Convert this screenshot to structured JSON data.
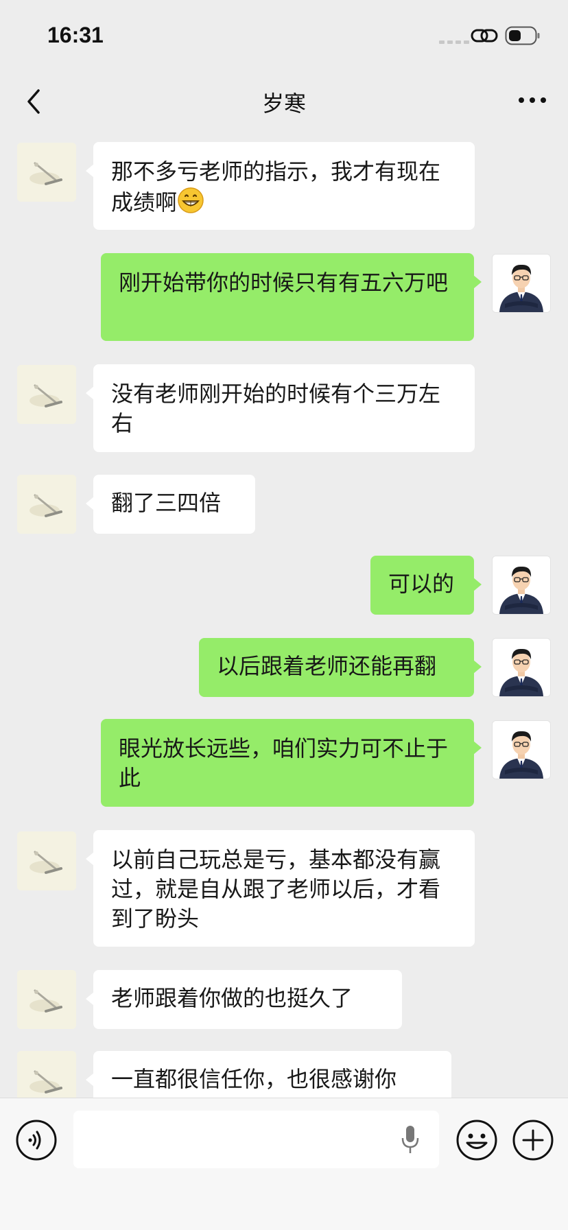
{
  "status_bar": {
    "time": "16:31"
  },
  "header": {
    "title": "岁寒",
    "back_icon": "chevron-left-icon",
    "more_icon": "more-dots-icon"
  },
  "messages": [
    {
      "side": "left",
      "text": "那不多亏老师的指示，我才有现在成绩啊",
      "emoji": "grinning-emoji"
    },
    {
      "side": "right",
      "text": "刚开始带你的时候只有有五六万吧"
    },
    {
      "side": "left",
      "text": "没有老师刚开始的时候有个三万左右"
    },
    {
      "side": "left",
      "text": "翻了三四倍"
    },
    {
      "side": "right",
      "text": "可以的"
    },
    {
      "side": "right",
      "text": "以后跟着老师还能再翻"
    },
    {
      "side": "right",
      "text": "眼光放长远些，咱们实力可不止于此"
    },
    {
      "side": "left",
      "text": "以前自己玩总是亏，基本都没有赢过，就是自从跟了老师以后，才看到了盼头"
    },
    {
      "side": "left",
      "text": "老师跟着你做的也挺久了"
    },
    {
      "side": "left",
      "text": "一直都很信任你，也很感谢你"
    }
  ],
  "input_bar": {
    "placeholder": "",
    "icons": [
      "voice-icon",
      "mic-icon",
      "emoji-icon",
      "plus-icon"
    ]
  },
  "colors": {
    "background": "#ededed",
    "sent_bubble": "#95ec69",
    "received_bubble": "#ffffff"
  }
}
